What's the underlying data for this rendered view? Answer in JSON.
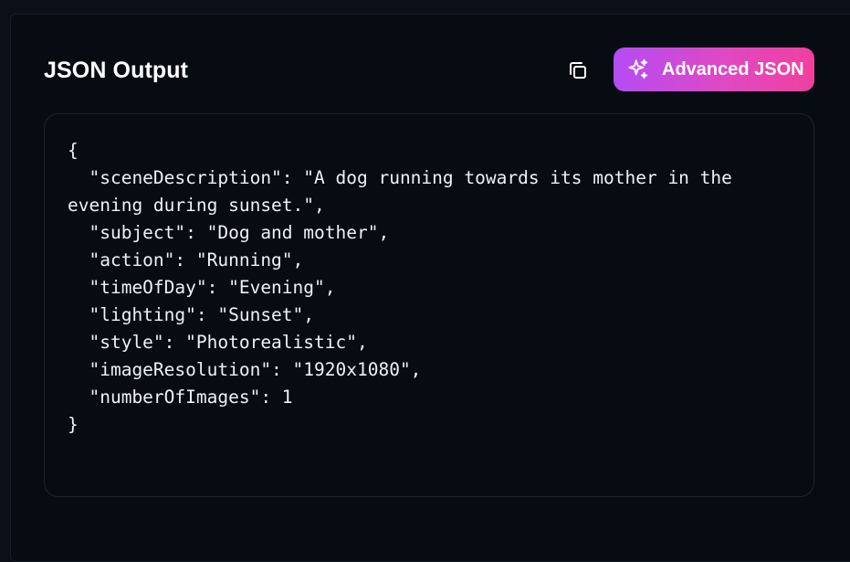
{
  "header": {
    "title": "JSON Output",
    "advanced_label": "Advanced JSON"
  },
  "icons": {
    "copy": "copy-icon",
    "advanced": "sparkles-icon"
  },
  "colors": {
    "background": "#070b12",
    "gradient_start": "#b44cf5",
    "gradient_end": "#f0409f",
    "text": "#eef1f5"
  },
  "code_lines": [
    "{",
    "  \"sceneDescription\": \"A dog running towards its mother in the",
    "evening during sunset.\",",
    "  \"subject\": \"Dog and mother\",",
    "  \"action\": \"Running\",",
    "  \"timeOfDay\": \"Evening\",",
    "  \"lighting\": \"Sunset\",",
    "  \"style\": \"Photorealistic\",",
    "  \"imageResolution\": \"1920x1080\",",
    "  \"numberOfImages\": 1",
    "}"
  ]
}
